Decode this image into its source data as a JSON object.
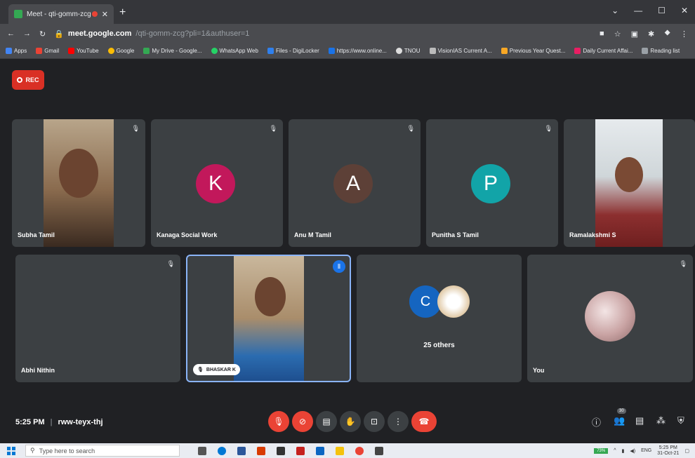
{
  "browser": {
    "tab_title": "Meet - qti-gomm-zcg",
    "new_tab": "+",
    "url_host": "meet.google.com",
    "url_path": "/qti-gomm-zcg?pli=1&authuser=1",
    "bookmarks": [
      "Apps",
      "Gmail",
      "YouTube",
      "Google",
      "My Drive - Google...",
      "WhatsApp Web",
      "Files - DigiLocker",
      "https://www.online...",
      "TNOU",
      "VisionIAS Current A...",
      "Previous Year Quest...",
      "Daily Current Affai...",
      "Reading list"
    ]
  },
  "meet": {
    "rec_label": "REC",
    "tiles_top": [
      {
        "name": "Subha Tamil"
      },
      {
        "name": "Kanaga Social Work",
        "initial": "K",
        "color": "#c2185b"
      },
      {
        "name": "Anu M Tamil",
        "initial": "A",
        "color": "#5d4037"
      },
      {
        "name": "Punitha S Tamil",
        "initial": "P",
        "color": "#12a4a8"
      },
      {
        "name": "Ramalakshmi S"
      }
    ],
    "tiles_bottom": [
      {
        "name": "Abhi Nithin"
      },
      {
        "name": "BHASKAR K"
      },
      {
        "name": "25 others",
        "initial": "C",
        "color": "#1565c0"
      },
      {
        "name": "You"
      }
    ],
    "time": "5:25 PM",
    "separator": "|",
    "meeting_code": "rww-teyx-thj",
    "participants_count": "30"
  },
  "taskbar": {
    "search_placeholder": "Type here to search",
    "battery": "73%",
    "lang": "ENG",
    "clock_time": "5:25 PM",
    "clock_date": "31-Oct-21"
  },
  "colors": {
    "accent_red": "#ea4335",
    "speaking_blue": "#8ab4f8"
  }
}
